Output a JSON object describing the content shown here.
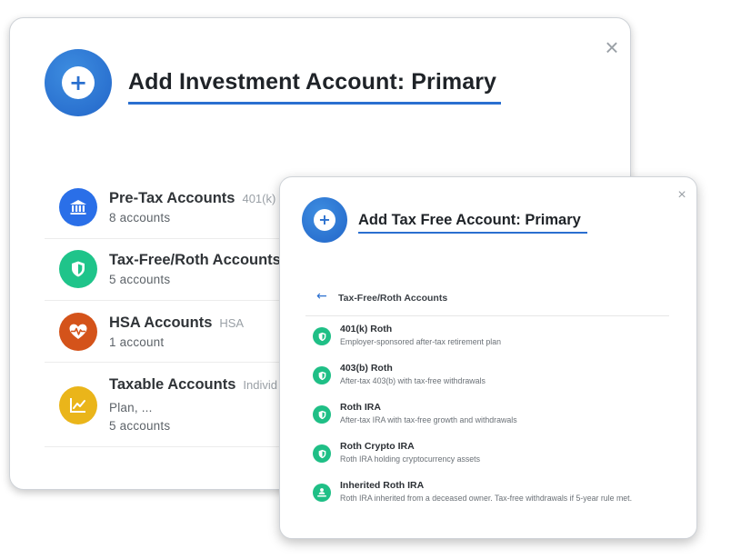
{
  "investment_dialog": {
    "title": "Add Investment Account: Primary",
    "close_label": "×",
    "plus_label": "+",
    "accounts": [
      {
        "name": "Pre-Tax Accounts",
        "tag": "401(k)",
        "line1": "8 accounts",
        "line2": "",
        "icon": "bank-icon",
        "color": "#2a6fe8"
      },
      {
        "name": "Tax-Free/Roth Accounts",
        "tag": "",
        "line1": "5 accounts",
        "line2": "",
        "icon": "shield-icon",
        "color": "#1fc48a"
      },
      {
        "name": "HSA Accounts",
        "tag": "HSA",
        "line1": "1 account",
        "line2": "",
        "icon": "heart-pulse-icon",
        "color": "#d4531a"
      },
      {
        "name": "Taxable Accounts",
        "tag": "Individ",
        "line1": "Plan, ...",
        "line2": "5 accounts",
        "icon": "chart-icon",
        "color": "#eab51a"
      }
    ]
  },
  "taxfree_dialog": {
    "title": "Add Tax Free Account: Primary",
    "close_label": "×",
    "plus_label": "+",
    "back_arrow": "←",
    "section_label": "Tax-Free/Roth Accounts",
    "options": [
      {
        "name": "401(k) Roth",
        "desc": "Employer-sponsored after-tax retirement plan",
        "icon": "shield-icon"
      },
      {
        "name": "403(b) Roth",
        "desc": "After-tax 403(b) with tax-free withdrawals",
        "icon": "shield-icon"
      },
      {
        "name": "Roth IRA",
        "desc": "After-tax IRA with tax-free growth and withdrawals",
        "icon": "shield-icon"
      },
      {
        "name": "Roth Crypto IRA",
        "desc": "Roth IRA holding cryptocurrency assets",
        "icon": "shield-icon"
      },
      {
        "name": "Inherited Roth IRA",
        "desc": "Roth IRA inherited from a deceased owner. Tax-free withdrawals if 5-year rule met.",
        "icon": "person-hand-icon"
      }
    ]
  }
}
